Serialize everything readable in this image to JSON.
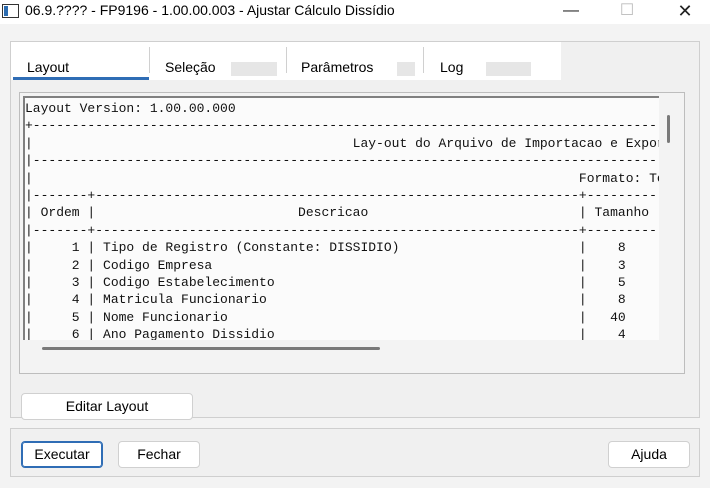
{
  "window": {
    "title": "06.9.???? - FP9196 - 1.00.00.003 - Ajustar Cálculo Dissídio",
    "min_glyph": "—",
    "max_glyph": "☐",
    "close_glyph": "✕"
  },
  "tabs": {
    "layout": "Layout",
    "selecao": "Seleção",
    "parametros": "Parâmetros",
    "log": "Log",
    "active": "Layout"
  },
  "document": {
    "lines": [
      "Layout Version: 1.00.00.000",
      "+--------------------------------------------------------------------------------------------------------",
      "|                                         Lay-out do Arquivo de Importacao e Exportacao",
      "|--------------------------------------------------------------------------------------------------------",
      "|                                                                      Formato: Texto",
      "|-------+--------------------------------------------------------------+---------------------------------",
      "| Ordem |                          Descricao                           | Tamanho |",
      "|-------+--------------------------------------------------------------+---------------------------------",
      "|     1 | Tipo de Registro (Constante: DISSIDIO)                       |    8    |",
      "|     2 | Codigo Empresa                                               |    3    |",
      "|     3 | Codigo Estabelecimento                                       |    5    |",
      "|     4 | Matricula Funcionario                                        |    8    |",
      "|     5 | Nome Funcionario                                             |   40    |",
      "|     6 | Ano Pagamento Dissidio                                       |    4    |"
    ]
  },
  "buttons": {
    "edit_layout": "Editar Layout",
    "execute": "Executar",
    "close": "Fechar",
    "help": "Ajuda"
  }
}
